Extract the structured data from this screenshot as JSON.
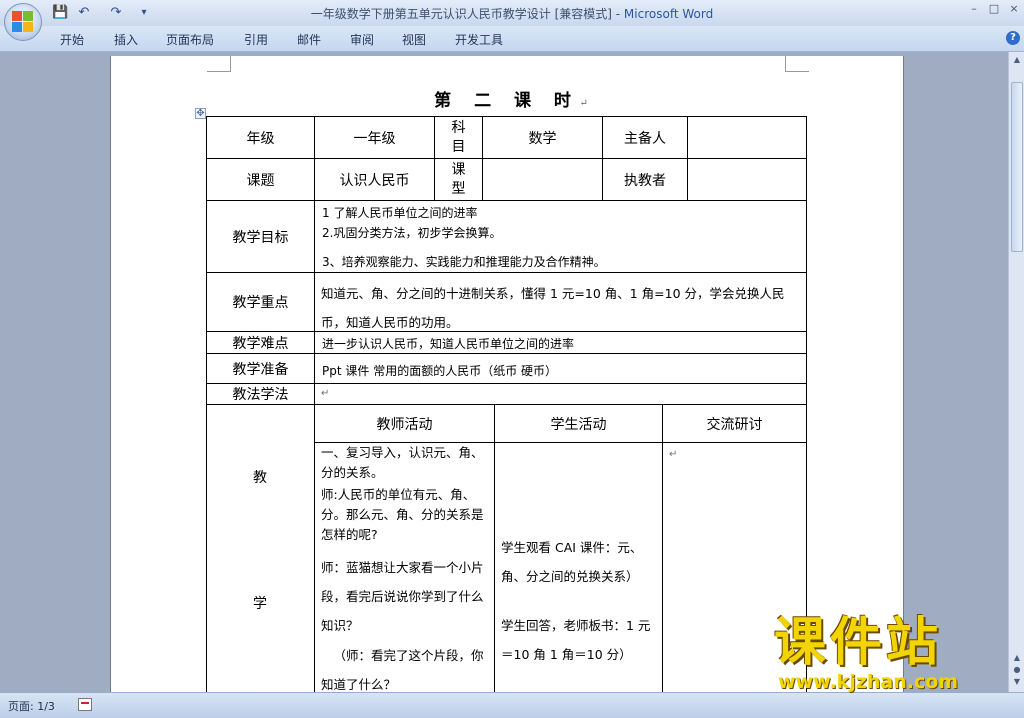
{
  "window": {
    "title": "一年级数学下册第五单元认识人民币教学设计 [兼容模式] - ",
    "app_name": "Microsoft Word",
    "minimize": "–",
    "maximize": "□",
    "close": "×"
  },
  "quick_access": {
    "save": "💾",
    "undo": "↶",
    "redo": "↷",
    "customize": "▾"
  },
  "ribbon": {
    "tabs": [
      "开始",
      "插入",
      "页面布局",
      "引用",
      "邮件",
      "审阅",
      "视图",
      "开发工具"
    ],
    "help": "?"
  },
  "document": {
    "heading": "第 二  课  时",
    "paragraph_mark": "↵",
    "table": {
      "row1": {
        "c1": "年级",
        "c2": "一年级",
        "c3a": "科",
        "c3b": "目",
        "c4": "数学",
        "c5": "主备人"
      },
      "row2": {
        "c1": "课题",
        "c2": "认识人民币",
        "c3a": "课",
        "c3b": "型",
        "c5": "执教者"
      },
      "goal_label": "教学目标",
      "goal_lines": [
        "1 了解人民币单位之间的进率",
        "2.巩固分类方法，初步学会换算。",
        "3、培养观察能力、实践能力和推理能力及合作精神。"
      ],
      "key_label": "教学重点",
      "key_text": "知道元、角、分之间的十进制关系，懂得 1 元=10 角、1 角=10 分，学会兑换人民币，知道人民币的功用。",
      "difficulty_label": "教学难点",
      "difficulty_text": "进一步认识人民币，知道人民币单位之间的进率",
      "prep_label": "教学准备",
      "prep_text": "Ppt 课件    常用的面额的人民币（纸币    硬币）",
      "method_label": "教法学法",
      "process_side_chars": [
        "教",
        "学"
      ],
      "col_headers": [
        "教师活动",
        "学生活动",
        "交流研讨"
      ],
      "teacher_activity": [
        "一、复习导入，认识元、角、分的关系。",
        "师:人民币的单位有元、角、分。那么元、角、分的关系是怎样的呢?",
        "师：蓝猫想让大家看一个小片段，看完后说说你学到了什么知识？",
        "（师：看完了这个片段，你知道了什么？"
      ],
      "student_activity": [
        "学生观看 CAI 课件：元、角、分之间的兑换关系）",
        "学生回答，老师板书：1 元＝10 角      1 角＝10 分）"
      ]
    }
  },
  "statusbar": {
    "page": "页面: 1/3"
  },
  "watermark": {
    "title": "课件站",
    "url": "www.kjzhan.com"
  }
}
